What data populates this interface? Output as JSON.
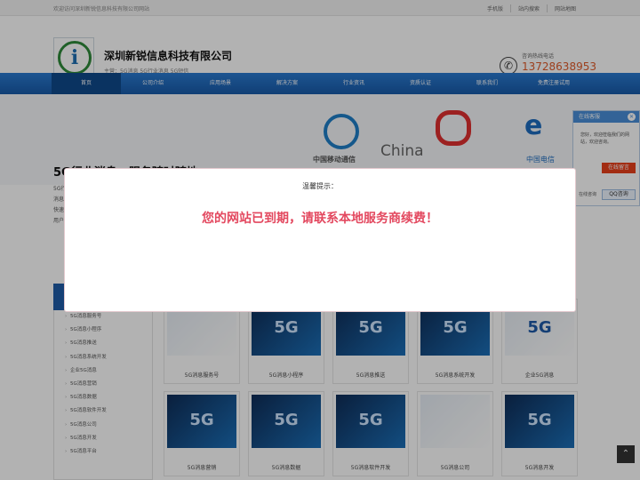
{
  "topbar": {
    "welcome": "欢迎访问深圳新锐信息科技有限公司网站",
    "links": [
      "手机版",
      "站内搜索",
      "网站地图"
    ]
  },
  "header": {
    "company": "深圳新锐信息科技有限公司",
    "tags": "主营：5G消息 5G行业消息 5G短信",
    "phone_label": "咨询热线电话",
    "phone_number": "13728638953"
  },
  "nav": {
    "items": [
      "首页",
      "公司介绍",
      "应用场景",
      "解决方案",
      "行业资讯",
      "资质认证",
      "联系我们",
      "免费注册试用"
    ]
  },
  "banner": {
    "title": "5G行业消息，服务随时随地",
    "desc_lines": [
      "5G行",
      "消息",
      "快速",
      "用户"
    ],
    "china_text": "China",
    "cm_text": "中国移动通信",
    "ct_text": "中国电信"
  },
  "kefu": {
    "title": "在线客服",
    "greeting": "您好，欢迎莅临我们的网站，欢迎咨询。",
    "btn1": "在线留言",
    "label": "在线咨询",
    "btn2": "QQ咨询"
  },
  "sidebar": {
    "items": [
      "5G消息服务号",
      "5G消息小程序",
      "5G消息推送",
      "5G消息系统开发",
      "企业5G消息",
      "5G消息营销",
      "5G消息数据",
      "5G消息软件开发",
      "5G消息公司",
      "5G消息开发",
      "5G消息平台"
    ]
  },
  "products": {
    "row1": [
      "5G消息服务号",
      "5G消息小程序",
      "5G消息推送",
      "5G消息系统开发",
      "企业5G消息"
    ],
    "row2": [
      "5G消息营销",
      "5G消息数据",
      "5G消息软件开发",
      "5G消息公司",
      "5G消息开发"
    ]
  },
  "modal": {
    "title": "温馨提示：",
    "message": "您的网站已到期，请联系本地服务商续费！"
  },
  "colors": {
    "nav": "#1f66b8",
    "accent": "#e3485f",
    "phone": "#e05b2a"
  }
}
